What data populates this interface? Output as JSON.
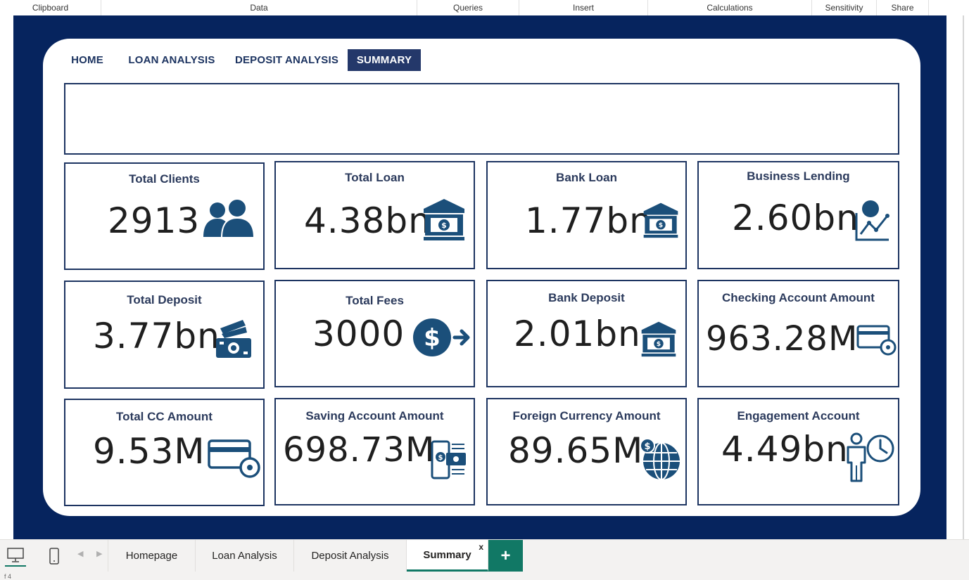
{
  "ribbon": {
    "groups": [
      "Clipboard",
      "Data",
      "Queries",
      "Insert",
      "Calculations",
      "Sensitivity",
      "Share"
    ]
  },
  "nav": {
    "items": [
      {
        "label": "HOME"
      },
      {
        "label": "LOAN ANALYSIS"
      },
      {
        "label": "DEPOSIT ANALYSIS"
      },
      {
        "label": "SUMMARY",
        "active": true
      }
    ]
  },
  "kpis": [
    {
      "label": "Total Clients",
      "value": "2913",
      "icon": "people-icon"
    },
    {
      "label": "Total Loan",
      "value": "4.38bn",
      "icon": "bank-icon"
    },
    {
      "label": "Bank Loan",
      "value": "1.77bn",
      "icon": "bank-icon"
    },
    {
      "label": "Business Lending",
      "value": "2.60bn",
      "icon": "growth-chart-icon"
    },
    {
      "label": "Total Deposit",
      "value": "3.77bn",
      "icon": "cash-icon"
    },
    {
      "label": "Total Fees",
      "value": "3000",
      "icon": "dollar-transfer-icon"
    },
    {
      "label": "Bank Deposit",
      "value": "2.01bn",
      "icon": "bank-icon"
    },
    {
      "label": "Checking Account Amount",
      "value": "963.28M",
      "icon": "card-settings-icon"
    },
    {
      "label": "Total CC Amount",
      "value": "9.53M",
      "icon": "card-settings-icon"
    },
    {
      "label": "Saving Account Amount",
      "value": "698.73M",
      "icon": "mobile-payment-icon"
    },
    {
      "label": "Foreign Currency Amount",
      "value": "89.65M",
      "icon": "globe-dollar-icon"
    },
    {
      "label": "Engagement Account",
      "value": "4.49bn",
      "icon": "person-clock-icon"
    }
  ],
  "tabs": [
    {
      "label": "Homepage"
    },
    {
      "label": "Loan Analysis"
    },
    {
      "label": "Deposit Analysis"
    },
    {
      "label": "Summary",
      "active": true
    }
  ],
  "tab_close": "x",
  "add_tab": "+",
  "status": "f 4",
  "colors": {
    "navy": "#06245e",
    "accent": "#1d3461",
    "icon": "#1b4f7a",
    "tab_accent": "#117865"
  }
}
